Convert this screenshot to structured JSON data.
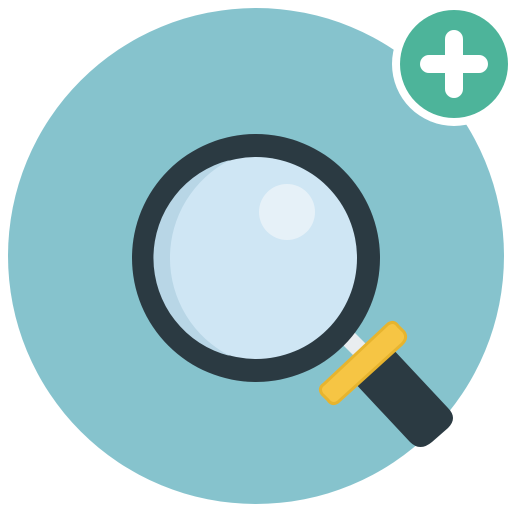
{
  "icon": {
    "name": "zoom-in-add-icon",
    "main_symbol": "magnifying-glass-icon",
    "badge_symbol": "plus-icon"
  },
  "colors": {
    "background": "#ffffff",
    "circle": "#86c3cd",
    "glass_lens": "#cfe6f4",
    "glass_shade": "#b8d6e6",
    "glass_highlight": "#e6f1f8",
    "frame": "#2b3a42",
    "handle_band": "#f6c544",
    "handle_band_stroke": "#e7b42e",
    "neck": "#e9edf0",
    "badge_fill": "#4db49a",
    "badge_ring": "#ffffff",
    "badge_plus": "#ffffff"
  }
}
